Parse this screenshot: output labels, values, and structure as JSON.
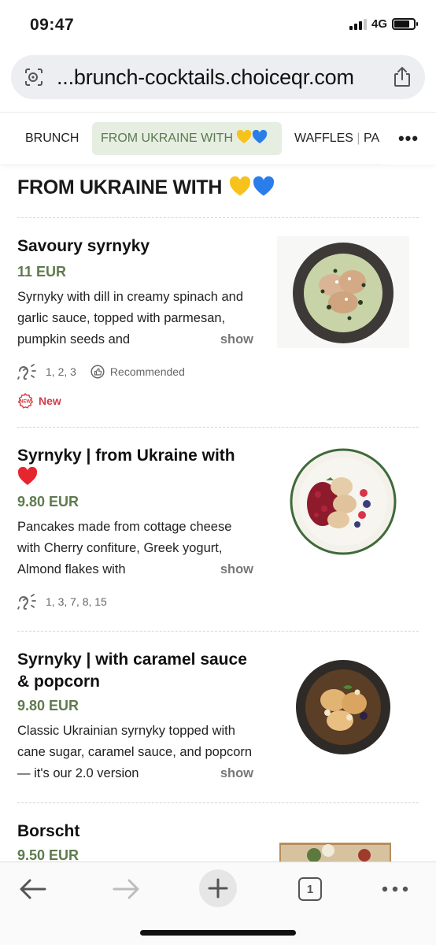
{
  "status": {
    "time": "09:47",
    "network": "4G"
  },
  "browser": {
    "url_display": "...brunch-cocktails.choiceqr.com"
  },
  "tabs": [
    {
      "label": "BRUNCH"
    },
    {
      "label": "FROM UKRAINE WITH"
    },
    {
      "label": "WAFFLES",
      "label_suffix": "PA"
    }
  ],
  "section": {
    "title": "FROM UKRAINE WITH"
  },
  "items": [
    {
      "name": "Savoury syrnyky",
      "price": "11 EUR",
      "description": "Syrnyky with dill in creamy spinach and garlic sauce, topped with parmesan, pumpkin seeds and",
      "show_label": "show",
      "allergens": "1, 2, 3",
      "recommended_label": "Recommended",
      "new_label": "New"
    },
    {
      "name": "Syrnyky | from Ukraine with",
      "price": "9.80 EUR",
      "description": "Pancakes made from cottage cheese with Cherry confiture, Greek yogurt, Almond flakes with",
      "show_label": "show",
      "allergens": "1, 3, 7, 8, 15"
    },
    {
      "name": "Syrnyky | with caramel sauce & popcorn",
      "price": "9.80 EUR",
      "description": "Classic Ukrainian syrnyky topped with cane sugar, caramel sauce, and popcorn — it's our 2.0 version",
      "show_label": "show"
    },
    {
      "name": "Borscht",
      "price": "9.50 EUR"
    }
  ],
  "toolbar": {
    "tab_count": "1"
  },
  "colors": {
    "accent_green": "#5e7b4e",
    "new_red": "#d63a45",
    "tab_active_bg": "#e6eee2"
  }
}
